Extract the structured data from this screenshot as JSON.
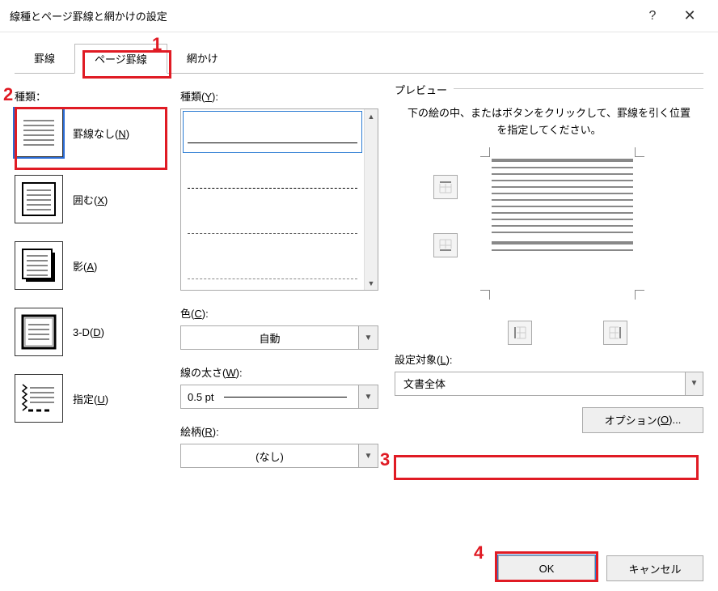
{
  "window": {
    "title": "線種とページ罫線と網かけの設定",
    "help": "?",
    "close": "✕"
  },
  "tabs": {
    "tab1": "罫線",
    "tab2": "ページ罫線",
    "tab3": "網かけ"
  },
  "settings": {
    "label": "種類：",
    "opts": [
      {
        "label": "罫線なし(",
        "key": "N",
        "suffix": ")"
      },
      {
        "label": "囲む(",
        "key": "X",
        "suffix": ")"
      },
      {
        "label": "影(",
        "key": "A",
        "suffix": ")"
      },
      {
        "label": "3-D(",
        "key": "D",
        "suffix": ")"
      },
      {
        "label": "指定(",
        "key": "U",
        "suffix": ")"
      }
    ]
  },
  "style": {
    "label_pre": "種類(",
    "label_key": "Y",
    "label_suf": "):"
  },
  "color": {
    "label_pre": "色(",
    "label_key": "C",
    "label_suf": "):",
    "value": "自動"
  },
  "width": {
    "label_pre": "線の太さ(",
    "label_key": "W",
    "label_suf": "):",
    "value": "0.5 pt"
  },
  "art": {
    "label_pre": "絵柄(",
    "label_key": "R",
    "label_suf": "):",
    "value": "(なし)"
  },
  "preview": {
    "legend": "プレビュー",
    "text": "下の絵の中、またはボタンをクリックして、罫線を引く位置を指定してください。"
  },
  "apply": {
    "label_pre": "設定対象(",
    "label_key": "L",
    "label_suf": "):",
    "value": "文書全体"
  },
  "options": {
    "label_pre": "オプション(",
    "label_key": "O",
    "label_suf": ")..."
  },
  "buttons": {
    "ok": "OK",
    "cancel": "キャンセル"
  },
  "annot": {
    "n1": "1",
    "n2": "2",
    "n3": "3",
    "n4": "4"
  }
}
